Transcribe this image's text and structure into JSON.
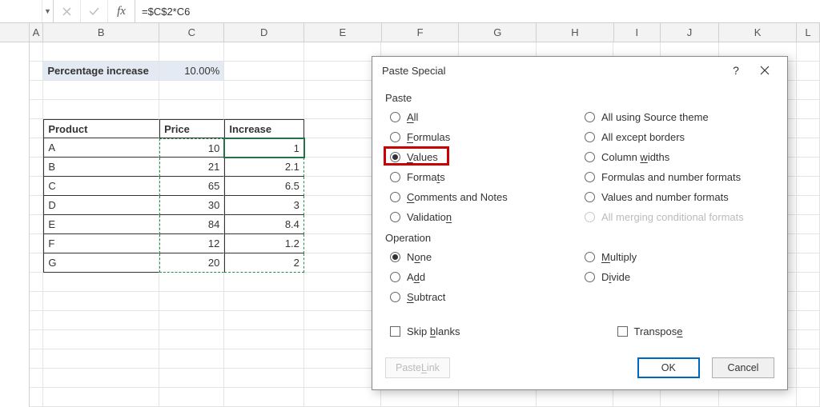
{
  "formula_bar": {
    "name_box": "",
    "cancel_glyph": "✕",
    "accept_glyph": "✓",
    "fx_label": "fx",
    "formula": "=$C$2*C6"
  },
  "columns": [
    "A",
    "B",
    "C",
    "D",
    "E",
    "F",
    "G",
    "H",
    "I",
    "J",
    "K",
    "L"
  ],
  "sheet": {
    "percent_label": "Percentage increase",
    "percent_value": "10.00%",
    "headers": {
      "product": "Product",
      "price": "Price",
      "increase": "Increase"
    },
    "rows": [
      {
        "product": "A",
        "price": "10",
        "increase": "1"
      },
      {
        "product": "B",
        "price": "21",
        "increase": "2.1"
      },
      {
        "product": "C",
        "price": "65",
        "increase": "6.5"
      },
      {
        "product": "D",
        "price": "30",
        "increase": "3"
      },
      {
        "product": "E",
        "price": "84",
        "increase": "8.4"
      },
      {
        "product": "F",
        "price": "12",
        "increase": "1.2"
      },
      {
        "product": "G",
        "price": "20",
        "increase": "2"
      }
    ]
  },
  "dialog": {
    "title": "Paste Special",
    "help_glyph": "?",
    "close_glyph": "✕",
    "paste_section": "Paste",
    "operation_section": "Operation",
    "opts_left": {
      "all": "All",
      "formulas": "Formulas",
      "values": "Values",
      "formats": "Formats",
      "comments": "Comments and Notes",
      "validation": "Validation"
    },
    "opts_right": {
      "source_theme": "All using Source theme",
      "except_borders": "All except borders",
      "col_widths": "Column widths",
      "num_formulas": "Formulas and number formats",
      "num_values": "Values and number formats",
      "merge_cond": "All merging conditional formats"
    },
    "ops_left": {
      "none": "None",
      "add": "Add",
      "subtract": "Subtract"
    },
    "ops_right": {
      "multiply": "Multiply",
      "divide": "Divide"
    },
    "skip_blanks": "Skip blanks",
    "transpose": "Transpose",
    "paste_link": "Paste Link",
    "ok": "OK",
    "cancel": "Cancel"
  }
}
